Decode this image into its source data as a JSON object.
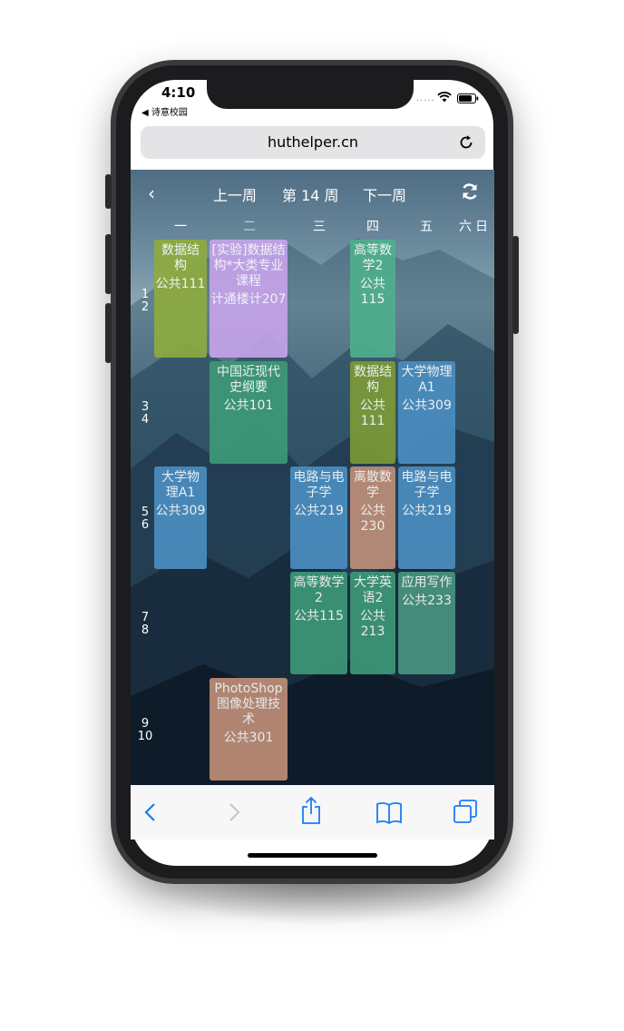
{
  "status": {
    "time": "4:10",
    "back_app": "◀ 诗意校园",
    "dots": "....."
  },
  "browser": {
    "url": "huthelper.cn"
  },
  "nav": {
    "back": "‹",
    "prev_week": "上一周",
    "week_label": "第 14 周",
    "next_week": "下一周"
  },
  "days": [
    "一",
    "二",
    "三",
    "四",
    "五",
    "六",
    "日"
  ],
  "periods": [
    {
      "a": "1",
      "b": "2"
    },
    {
      "a": "3",
      "b": "4"
    },
    {
      "a": "5",
      "b": "6"
    },
    {
      "a": "7",
      "b": "8"
    },
    {
      "a": "9",
      "b": "10"
    }
  ],
  "courses": [
    {
      "name": "数据结构",
      "room": "公共111",
      "day": 1,
      "slot": 1,
      "color": "#8fac3e"
    },
    {
      "name": "[实验]数据结构*大类专业课程",
      "room": "计通楼计207",
      "day": 2,
      "slot": 1,
      "color": "#c7a4ec"
    },
    {
      "name": "高等数学2",
      "room": "公共115",
      "day": 4,
      "slot": 1,
      "color": "#4fb08c"
    },
    {
      "name": "中国近现代史纲要",
      "room": "公共101",
      "day": 2,
      "slot": 2,
      "color": "#3e9a78"
    },
    {
      "name": "数据结构",
      "room": "公共111",
      "day": 4,
      "slot": 2,
      "color": "#7d9b37"
    },
    {
      "name": "大学物理A1",
      "room": "公共309",
      "day": 5,
      "slot": 2,
      "color": "#4b8fc2"
    },
    {
      "name": "大学物理A1",
      "room": "公共309",
      "day": 1,
      "slot": 3,
      "color": "#4b8fc2"
    },
    {
      "name": "电路与电子学",
      "room": "公共219",
      "day": 3,
      "slot": 3,
      "color": "#4b8fc2"
    },
    {
      "name": "离散数学",
      "room": "公共230",
      "day": 4,
      "slot": 3,
      "color": "#c19179"
    },
    {
      "name": "电路与电子学",
      "room": "公共219",
      "day": 5,
      "slot": 3,
      "color": "#4b8fc2"
    },
    {
      "name": "高等数学2",
      "room": "公共115",
      "day": 3,
      "slot": 4,
      "color": "#3e9a78"
    },
    {
      "name": "大学英语2",
      "room": "公共213",
      "day": 4,
      "slot": 4,
      "color": "#3e9a78"
    },
    {
      "name": "应用写作",
      "room": "公共233",
      "day": 5,
      "slot": 4,
      "color": "#4a9680"
    },
    {
      "name": "PhotoShop图像处理技术",
      "room": "公共301",
      "day": 2,
      "slot": 5,
      "color": "#c19179"
    }
  ],
  "toolbar": {
    "back_icon": "chevron-left-icon",
    "forward_icon": "chevron-right-icon",
    "share_icon": "share-icon",
    "bookmarks_icon": "book-icon",
    "tabs_icon": "tabs-icon",
    "accent": "#1a7cf5"
  }
}
